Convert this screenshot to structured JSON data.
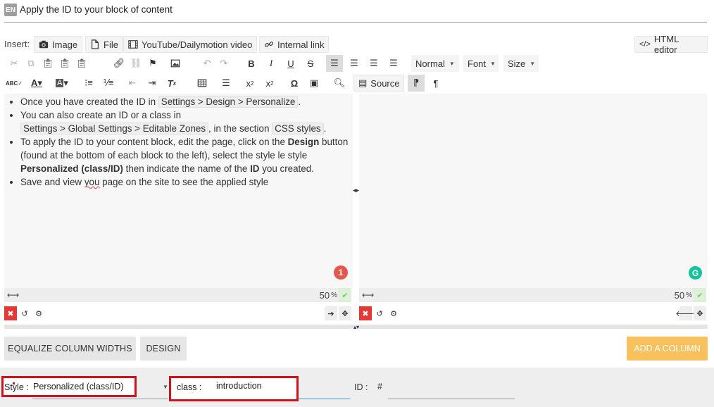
{
  "header": {
    "lang_badge": "EN",
    "title": "Apply the ID to your block of content"
  },
  "insert": {
    "label": "Insert:",
    "buttons": {
      "image": "Image",
      "file": "File",
      "video": "YouTube/Dailymotion video",
      "internal_link": "Internal link"
    },
    "html_editor": "HTML editor"
  },
  "toolbar": {
    "format": "Normal",
    "font": "Font",
    "size": "Size",
    "source": "Source"
  },
  "content": {
    "b1_pre": "Once you have created the ID in",
    "b1_chip": "Settings > Design > Personalize",
    "b1_post": ".",
    "b2_line1": "You can also create an ID or a class in",
    "b2_chip": "Settings > Global Settings > Editable Zones",
    "b2_mid": ", in the section",
    "b2_chip2": "CSS styles",
    "b2_post": ".",
    "b3_pre": "To apply the ID to your content block, edit the page, click on the",
    "b3_bold1": "Design",
    "b3_mid": "button (found at the bottom of each block to the left), select the style   le style",
    "b3_bold2": "Personalized (class/ID)",
    "b3_mid2": "then indicate the name of the",
    "b3_bold3": "ID",
    "b3_post": "you created.",
    "b4_pre": "Save and view",
    "b4_err": "you",
    "b4_post": "page on the site to see the applied style"
  },
  "badges": {
    "notification": "1",
    "grammarly": "G"
  },
  "columns": {
    "left_width": "50",
    "right_width": "50",
    "pct_sign": "%"
  },
  "actions": {
    "equalize": "EQUALIZE COLUMN WIDTHS",
    "design": "DESIGN",
    "add_column": "ADD A COLUMN"
  },
  "style_bar": {
    "style_label": "Style :",
    "style_value": "Personalized (class/ID)",
    "class_label": "class :",
    "class_value": "introduction",
    "id_label": "ID :",
    "id_hash": "#"
  }
}
